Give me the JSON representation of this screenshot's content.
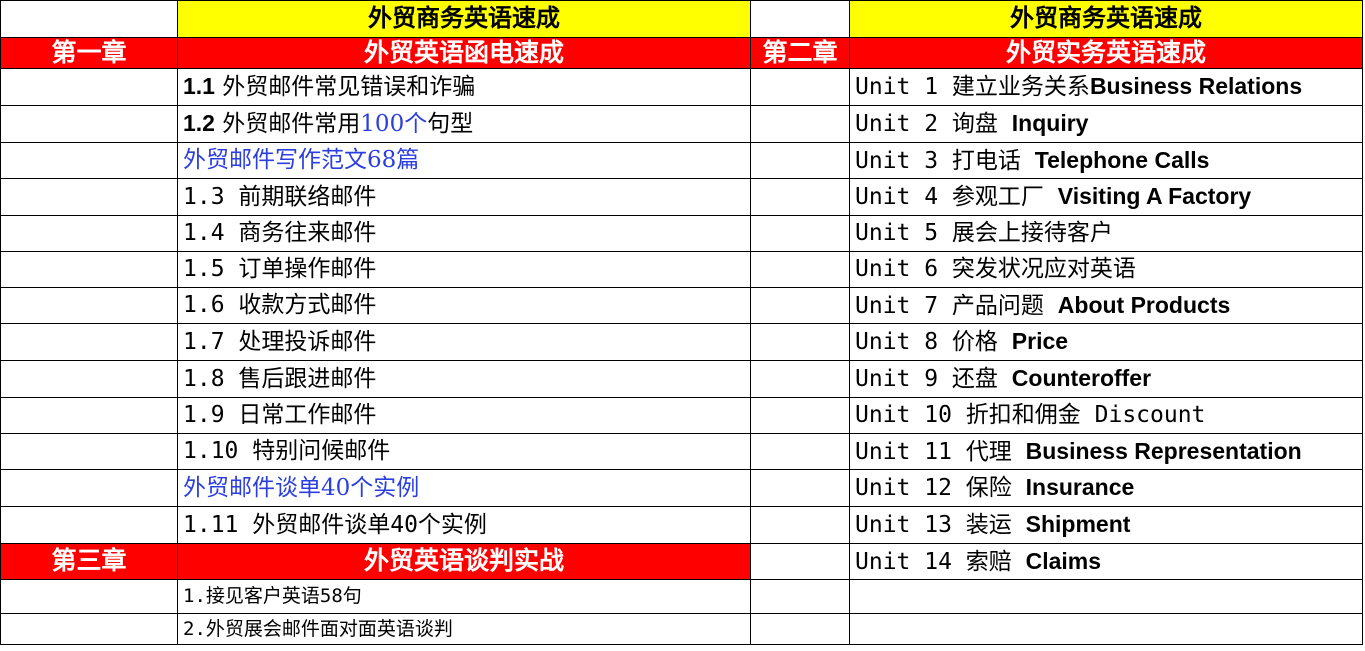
{
  "left": {
    "header": "外贸商务英语速成",
    "chapter1": {
      "label": "第一章",
      "title": "外贸英语函电速成"
    },
    "rows": [
      {
        "num": "1.1",
        "text": " 外贸邮件常见错误和诈骗"
      },
      {
        "num": "1.2",
        "text_a": " 外贸邮件常用",
        "text_hl": "100个",
        "text_b": "句型"
      },
      {
        "text": "外贸邮件写作范文68篇"
      },
      {
        "text": "1.3 前期联络邮件"
      },
      {
        "text": "1.4 商务往来邮件"
      },
      {
        "text": "1.5 订单操作邮件"
      },
      {
        "text": "1.6 收款方式邮件"
      },
      {
        "text": "1.7 处理投诉邮件"
      },
      {
        "text": "1.8 售后跟进邮件"
      },
      {
        "text": "1.9 日常工作邮件"
      },
      {
        "text": "1.10 特别问候邮件"
      },
      {
        "text": "外贸邮件谈单40个实例"
      },
      {
        "text": "1.11 外贸邮件谈单40个实例"
      }
    ],
    "chapter3": {
      "label": "第三章",
      "title": "外贸英语谈判实战"
    },
    "rows3": [
      {
        "text": "1.接见客户英语58句"
      },
      {
        "text": "2.外贸展会邮件面对面英语谈判"
      }
    ]
  },
  "right": {
    "header": "外贸商务英语速成",
    "chapter2": {
      "label": "第二章",
      "title": "外贸实务英语速成"
    },
    "units": [
      {
        "unit": "Unit 1 建立业务关系",
        "en": "Business Relations"
      },
      {
        "unit": "Unit 2 询盘 ",
        "en": "Inquiry"
      },
      {
        "unit": "Unit 3 打电话 ",
        "en": "Telephone Calls"
      },
      {
        "unit": "Unit 4 参观工厂 ",
        "en": "Visiting A Factory"
      },
      {
        "unit": "Unit 5 展会上接待客户",
        "en": ""
      },
      {
        "unit": "Unit 6 突发状况应对英语",
        "en": ""
      },
      {
        "unit": "Unit 7 产品问题 ",
        "en": "About Products"
      },
      {
        "unit": "Unit 8 价格 ",
        "en": "Price"
      },
      {
        "unit": "Unit 9 还盘 ",
        "en": "Counteroffer"
      },
      {
        "unit": "Unit 10 折扣和佣金 Discount",
        "en": ""
      },
      {
        "unit": "Unit 11 代理 ",
        "en": "Business Representation"
      },
      {
        "unit": "Unit 12 保险 ",
        "en": "Insurance"
      },
      {
        "unit": "Unit 13 装运 ",
        "en": "Shipment"
      },
      {
        "unit": "Unit 14 索赔 ",
        "en": "Claims"
      }
    ]
  },
  "colors": {
    "header_bg": "#ffff00",
    "chapter_bg": "#ff0000",
    "link_blue": "#2b3ee0"
  }
}
